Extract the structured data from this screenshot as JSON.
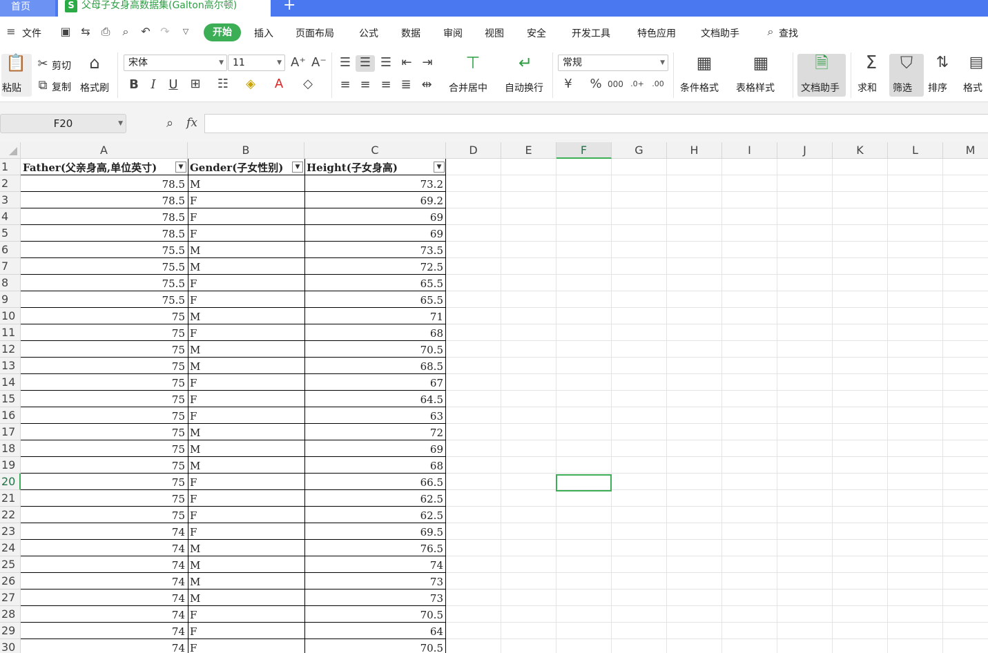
{
  "tabs": {
    "home": "首页",
    "active_file": "父母子女身高数据集(Galton高尔顿)",
    "unsaved_dot": "●",
    "new_tab": "+"
  },
  "menu": {
    "file": "文件",
    "items": [
      "开始",
      "插入",
      "页面布局",
      "公式",
      "数据",
      "审阅",
      "视图",
      "安全",
      "开发工具",
      "特色应用",
      "文档助手",
      "查找"
    ]
  },
  "ribbon": {
    "paste": "粘贴",
    "cut": "剪切",
    "copy": "复制",
    "format_painter": "格式刷",
    "font_name": "宋体",
    "font_size": "11",
    "bold": "B",
    "italic": "I",
    "underline": "U",
    "merge_center": "合并居中",
    "wrap_text": "自动换行",
    "number_format": "常规",
    "conditional_format": "条件格式",
    "table_style": "表格样式",
    "doc_assistant": "文档助手",
    "sum": "求和",
    "filter": "筛选",
    "sort": "排序",
    "format": "格式"
  },
  "formula_bar": {
    "name_box": "F20",
    "fx": "fx",
    "formula": ""
  },
  "sheet": {
    "columns": [
      "A",
      "B",
      "C",
      "D",
      "E",
      "F",
      "G",
      "H",
      "I",
      "J",
      "K",
      "L",
      "M"
    ],
    "selected_column": "F",
    "selected_row": "20",
    "headers": [
      "Father(父亲身高,单位英寸)",
      "Gender(子女性别)",
      "Height(子女身高)"
    ],
    "rows": [
      [
        "78.5",
        "M",
        "73.2"
      ],
      [
        "78.5",
        "F",
        "69.2"
      ],
      [
        "78.5",
        "F",
        "69"
      ],
      [
        "78.5",
        "F",
        "69"
      ],
      [
        "75.5",
        "M",
        "73.5"
      ],
      [
        "75.5",
        "M",
        "72.5"
      ],
      [
        "75.5",
        "F",
        "65.5"
      ],
      [
        "75.5",
        "F",
        "65.5"
      ],
      [
        "75",
        "M",
        "71"
      ],
      [
        "75",
        "F",
        "68"
      ],
      [
        "75",
        "M",
        "70.5"
      ],
      [
        "75",
        "M",
        "68.5"
      ],
      [
        "75",
        "F",
        "67"
      ],
      [
        "75",
        "F",
        "64.5"
      ],
      [
        "75",
        "F",
        "63"
      ],
      [
        "75",
        "M",
        "72"
      ],
      [
        "75",
        "M",
        "69"
      ],
      [
        "75",
        "M",
        "68"
      ],
      [
        "75",
        "F",
        "66.5"
      ],
      [
        "75",
        "F",
        "62.5"
      ],
      [
        "75",
        "F",
        "62.5"
      ],
      [
        "74",
        "F",
        "69.5"
      ],
      [
        "74",
        "M",
        "76.5"
      ],
      [
        "74",
        "M",
        "74"
      ],
      [
        "74",
        "M",
        "73"
      ],
      [
        "74",
        "M",
        "73"
      ],
      [
        "74",
        "F",
        "70.5"
      ],
      [
        "74",
        "F",
        "64"
      ],
      [
        "74",
        "F",
        "70.5"
      ]
    ]
  },
  "colors": {
    "tabbar": "#4a78f0",
    "accent_green": "#3cae56",
    "file_green": "#2e9e44"
  }
}
